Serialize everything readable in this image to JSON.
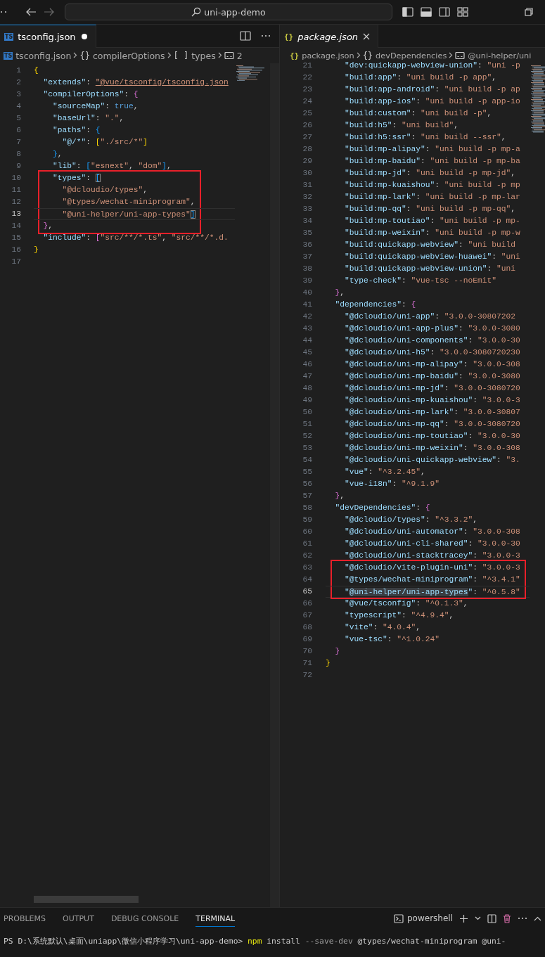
{
  "title_bar": {
    "search": "uni-app-demo"
  },
  "editors": [
    {
      "tab": {
        "kind": "ts",
        "badge": "TS",
        "label": "tsconfig.json",
        "modified": true,
        "preview": false,
        "selected": true
      },
      "breadcrumb": [
        {
          "kind": "ts",
          "badge": "TS",
          "label": "tsconfig.json"
        },
        {
          "kind": "object",
          "symbol": "{}",
          "label": "compilerOptions"
        },
        {
          "kind": "array",
          "symbol": "[ ]",
          "label": "types"
        },
        {
          "kind": "string",
          "label": "2"
        }
      ],
      "lines": [
        {
          "n": "1",
          "t": [
            {
              "kind": "brace1",
              "text": "{"
            }
          ],
          "current": false,
          "boxed": false
        },
        {
          "n": "2",
          "t": [
            {
              "kind": "key",
              "text": "  \"extends\""
            },
            {
              "kind": "punct",
              "text": ": "
            },
            {
              "kind": "link",
              "text": "\"@vue/tsconfig/tsconfig.json"
            }
          ],
          "current": false,
          "boxed": false
        },
        {
          "n": "3",
          "t": [
            {
              "kind": "key",
              "text": "  \"compilerOptions\""
            },
            {
              "kind": "punct",
              "text": ": "
            },
            {
              "kind": "brace2",
              "text": "{"
            }
          ],
          "current": false,
          "boxed": false
        },
        {
          "n": "4",
          "t": [
            {
              "kind": "key",
              "text": "    \"sourceMap\""
            },
            {
              "kind": "punct",
              "text": ": "
            },
            {
              "kind": "bool",
              "text": "true"
            },
            {
              "kind": "punct",
              "text": ","
            }
          ],
          "current": false,
          "boxed": false
        },
        {
          "n": "5",
          "t": [
            {
              "kind": "key",
              "text": "    \"baseUrl\""
            },
            {
              "kind": "punct",
              "text": ": "
            },
            {
              "kind": "str",
              "text": "\".\""
            },
            {
              "kind": "punct",
              "text": ","
            }
          ],
          "current": false,
          "boxed": false
        },
        {
          "n": "6",
          "t": [
            {
              "kind": "key",
              "text": "    \"paths\""
            },
            {
              "kind": "punct",
              "text": ": "
            },
            {
              "kind": "brace3",
              "text": "{"
            }
          ],
          "current": false,
          "boxed": false
        },
        {
          "n": "7",
          "t": [
            {
              "kind": "key",
              "text": "      \"@/*\""
            },
            {
              "kind": "punct",
              "text": ": "
            },
            {
              "kind": "brace1",
              "text": "["
            },
            {
              "kind": "str",
              "text": "\"./src/*\""
            },
            {
              "kind": "brace1",
              "text": "]"
            }
          ],
          "current": false,
          "boxed": false
        },
        {
          "n": "8",
          "t": [
            {
              "kind": "brace3",
              "text": "    }"
            },
            {
              "kind": "punct",
              "text": ","
            }
          ],
          "current": false,
          "boxed": false
        },
        {
          "n": "9",
          "t": [
            {
              "kind": "key",
              "text": "    \"lib\""
            },
            {
              "kind": "punct",
              "text": ": "
            },
            {
              "kind": "brace3",
              "text": "["
            },
            {
              "kind": "str",
              "text": "\"esnext\""
            },
            {
              "kind": "punct",
              "text": ", "
            },
            {
              "kind": "str",
              "text": "\"dom\""
            },
            {
              "kind": "brace3",
              "text": "]"
            },
            {
              "kind": "punct",
              "text": ","
            }
          ],
          "current": false,
          "boxed": false
        },
        {
          "n": "10",
          "t": [
            {
              "kind": "key",
              "text": "    \"types\""
            },
            {
              "kind": "punct",
              "text": ": "
            },
            {
              "kind": "match",
              "text": "["
            }
          ],
          "current": false,
          "boxed": true
        },
        {
          "n": "11",
          "t": [
            {
              "kind": "str",
              "text": "      \"@dcloudio/types\""
            },
            {
              "kind": "punct",
              "text": ","
            }
          ],
          "current": false,
          "boxed": true
        },
        {
          "n": "12",
          "t": [
            {
              "kind": "str",
              "text": "      \"@types/wechat-miniprogram\""
            },
            {
              "kind": "punct",
              "text": ","
            }
          ],
          "current": false,
          "boxed": true
        },
        {
          "n": "13",
          "t": [
            {
              "kind": "str",
              "text": "      \"@uni-helper/uni-app-types\""
            },
            {
              "kind": "match",
              "text": "]"
            }
          ],
          "current": true,
          "boxed": true
        },
        {
          "n": "14",
          "t": [
            {
              "kind": "brace2",
              "text": "  }"
            },
            {
              "kind": "punct",
              "text": ","
            }
          ],
          "current": false,
          "boxed": true
        },
        {
          "n": "15",
          "t": [
            {
              "kind": "key",
              "text": "  \"include\""
            },
            {
              "kind": "punct",
              "text": ": "
            },
            {
              "kind": "brace2",
              "text": "["
            },
            {
              "kind": "str",
              "text": "\"src/**/*.ts\""
            },
            {
              "kind": "punct",
              "text": ", "
            },
            {
              "kind": "str",
              "text": "\"src/**/*.d."
            }
          ],
          "current": false,
          "boxed": false
        },
        {
          "n": "16",
          "t": [
            {
              "kind": "brace1",
              "text": "}"
            }
          ],
          "current": false,
          "boxed": false
        },
        {
          "n": "17",
          "current": false,
          "boxed": false
        }
      ]
    },
    {
      "tab": {
        "kind": "json",
        "symbol": "{}",
        "label": "package.json",
        "modified": false,
        "preview": true,
        "selected": true
      },
      "breadcrumb": [
        {
          "kind": "json",
          "symbol": "{}",
          "label": "package.json"
        },
        {
          "kind": "object",
          "symbol": "{}",
          "label": "devDependencies"
        },
        {
          "kind": "string",
          "label": "@uni-helper/uni"
        }
      ],
      "lines": [
        {
          "n": "21",
          "t": [
            {
              "kind": "key",
              "text": "    \"dev:quickapp-webview-union\""
            },
            {
              "kind": "punct",
              "text": ": "
            },
            {
              "kind": "str",
              "text": "\"uni -p"
            }
          ],
          "current": false,
          "boxed": false
        },
        {
          "n": "22",
          "t": [
            {
              "kind": "key",
              "text": "    \"build:app\""
            },
            {
              "kind": "punct",
              "text": ": "
            },
            {
              "kind": "str",
              "text": "\"uni build -p app\""
            },
            {
              "kind": "punct",
              "text": ","
            }
          ],
          "current": false,
          "boxed": false
        },
        {
          "n": "23",
          "t": [
            {
              "kind": "key",
              "text": "    \"build:app-android\""
            },
            {
              "kind": "punct",
              "text": ": "
            },
            {
              "kind": "str",
              "text": "\"uni build -p ap"
            }
          ],
          "current": false,
          "boxed": false
        },
        {
          "n": "24",
          "t": [
            {
              "kind": "key",
              "text": "    \"build:app-ios\""
            },
            {
              "kind": "punct",
              "text": ": "
            },
            {
              "kind": "str",
              "text": "\"uni build -p app-io"
            }
          ],
          "current": false,
          "boxed": false
        },
        {
          "n": "25",
          "t": [
            {
              "kind": "key",
              "text": "    \"build:custom\""
            },
            {
              "kind": "punct",
              "text": ": "
            },
            {
              "kind": "str",
              "text": "\"uni build -p\""
            },
            {
              "kind": "punct",
              "text": ","
            }
          ],
          "current": false,
          "boxed": false
        },
        {
          "n": "26",
          "t": [
            {
              "kind": "key",
              "text": "    \"build:h5\""
            },
            {
              "kind": "punct",
              "text": ": "
            },
            {
              "kind": "str",
              "text": "\"uni build\""
            },
            {
              "kind": "punct",
              "text": ","
            }
          ],
          "current": false,
          "boxed": false
        },
        {
          "n": "27",
          "t": [
            {
              "kind": "key",
              "text": "    \"build:h5:ssr\""
            },
            {
              "kind": "punct",
              "text": ": "
            },
            {
              "kind": "str",
              "text": "\"uni build --ssr\""
            },
            {
              "kind": "punct",
              "text": ","
            }
          ],
          "current": false,
          "boxed": false
        },
        {
          "n": "28",
          "t": [
            {
              "kind": "key",
              "text": "    \"build:mp-alipay\""
            },
            {
              "kind": "punct",
              "text": ": "
            },
            {
              "kind": "str",
              "text": "\"uni build -p mp-a"
            }
          ],
          "current": false,
          "boxed": false
        },
        {
          "n": "29",
          "t": [
            {
              "kind": "key",
              "text": "    \"build:mp-baidu\""
            },
            {
              "kind": "punct",
              "text": ": "
            },
            {
              "kind": "str",
              "text": "\"uni build -p mp-ba"
            }
          ],
          "current": false,
          "boxed": false
        },
        {
          "n": "30",
          "t": [
            {
              "kind": "key",
              "text": "    \"build:mp-jd\""
            },
            {
              "kind": "punct",
              "text": ": "
            },
            {
              "kind": "str",
              "text": "\"uni build -p mp-jd\""
            },
            {
              "kind": "punct",
              "text": ","
            }
          ],
          "current": false,
          "boxed": false
        },
        {
          "n": "31",
          "t": [
            {
              "kind": "key",
              "text": "    \"build:mp-kuaishou\""
            },
            {
              "kind": "punct",
              "text": ": "
            },
            {
              "kind": "str",
              "text": "\"uni build -p mp"
            }
          ],
          "current": false,
          "boxed": false
        },
        {
          "n": "32",
          "t": [
            {
              "kind": "key",
              "text": "    \"build:mp-lark\""
            },
            {
              "kind": "punct",
              "text": ": "
            },
            {
              "kind": "str",
              "text": "\"uni build -p mp-lar"
            }
          ],
          "current": false,
          "boxed": false
        },
        {
          "n": "33",
          "t": [
            {
              "kind": "key",
              "text": "    \"build:mp-qq\""
            },
            {
              "kind": "punct",
              "text": ": "
            },
            {
              "kind": "str",
              "text": "\"uni build -p mp-qq\""
            },
            {
              "kind": "punct",
              "text": ","
            }
          ],
          "current": false,
          "boxed": false
        },
        {
          "n": "34",
          "t": [
            {
              "kind": "key",
              "text": "    \"build:mp-toutiao\""
            },
            {
              "kind": "punct",
              "text": ": "
            },
            {
              "kind": "str",
              "text": "\"uni build -p mp-"
            }
          ],
          "current": false,
          "boxed": false
        },
        {
          "n": "35",
          "t": [
            {
              "kind": "key",
              "text": "    \"build:mp-weixin\""
            },
            {
              "kind": "punct",
              "text": ": "
            },
            {
              "kind": "str",
              "text": "\"uni build -p mp-w"
            }
          ],
          "current": false,
          "boxed": false
        },
        {
          "n": "36",
          "t": [
            {
              "kind": "key",
              "text": "    \"build:quickapp-webview\""
            },
            {
              "kind": "punct",
              "text": ": "
            },
            {
              "kind": "str",
              "text": "\"uni build"
            }
          ],
          "current": false,
          "boxed": false
        },
        {
          "n": "37",
          "t": [
            {
              "kind": "key",
              "text": "    \"build:quickapp-webview-huawei\""
            },
            {
              "kind": "punct",
              "text": ": "
            },
            {
              "kind": "str",
              "text": "\"uni"
            }
          ],
          "current": false,
          "boxed": false
        },
        {
          "n": "38",
          "t": [
            {
              "kind": "key",
              "text": "    \"build:quickapp-webview-union\""
            },
            {
              "kind": "punct",
              "text": ": "
            },
            {
              "kind": "str",
              "text": "\"uni"
            }
          ],
          "current": false,
          "boxed": false
        },
        {
          "n": "39",
          "t": [
            {
              "kind": "key",
              "text": "    \"type-check\""
            },
            {
              "kind": "punct",
              "text": ": "
            },
            {
              "kind": "str",
              "text": "\"vue-tsc --noEmit\""
            }
          ],
          "current": false,
          "boxed": false
        },
        {
          "n": "40",
          "t": [
            {
              "kind": "brace2",
              "text": "  }"
            },
            {
              "kind": "punct",
              "text": ","
            }
          ],
          "current": false,
          "boxed": false
        },
        {
          "n": "41",
          "t": [
            {
              "kind": "key",
              "text": "  \"dependencies\""
            },
            {
              "kind": "punct",
              "text": ": "
            },
            {
              "kind": "brace2",
              "text": "{"
            }
          ],
          "current": false,
          "boxed": false
        },
        {
          "n": "42",
          "t": [
            {
              "kind": "key",
              "text": "    \"@dcloudio/uni-app\""
            },
            {
              "kind": "punct",
              "text": ": "
            },
            {
              "kind": "str",
              "text": "\"3.0.0-30807202"
            }
          ],
          "current": false,
          "boxed": false
        },
        {
          "n": "43",
          "t": [
            {
              "kind": "key",
              "text": "    \"@dcloudio/uni-app-plus\""
            },
            {
              "kind": "punct",
              "text": ": "
            },
            {
              "kind": "str",
              "text": "\"3.0.0-3080"
            }
          ],
          "current": false,
          "boxed": false
        },
        {
          "n": "44",
          "t": [
            {
              "kind": "key",
              "text": "    \"@dcloudio/uni-components\""
            },
            {
              "kind": "punct",
              "text": ": "
            },
            {
              "kind": "str",
              "text": "\"3.0.0-30"
            }
          ],
          "current": false,
          "boxed": false
        },
        {
          "n": "45",
          "t": [
            {
              "kind": "key",
              "text": "    \"@dcloudio/uni-h5\""
            },
            {
              "kind": "punct",
              "text": ": "
            },
            {
              "kind": "str",
              "text": "\"3.0.0-3080720230"
            }
          ],
          "current": false,
          "boxed": false
        },
        {
          "n": "46",
          "t": [
            {
              "kind": "key",
              "text": "    \"@dcloudio/uni-mp-alipay\""
            },
            {
              "kind": "punct",
              "text": ": "
            },
            {
              "kind": "str",
              "text": "\"3.0.0-308"
            }
          ],
          "current": false,
          "boxed": false
        },
        {
          "n": "47",
          "t": [
            {
              "kind": "key",
              "text": "    \"@dcloudio/uni-mp-baidu\""
            },
            {
              "kind": "punct",
              "text": ": "
            },
            {
              "kind": "str",
              "text": "\"3.0.0-3080"
            }
          ],
          "current": false,
          "boxed": false
        },
        {
          "n": "48",
          "t": [
            {
              "kind": "key",
              "text": "    \"@dcloudio/uni-mp-jd\""
            },
            {
              "kind": "punct",
              "text": ": "
            },
            {
              "kind": "str",
              "text": "\"3.0.0-3080720"
            }
          ],
          "current": false,
          "boxed": false
        },
        {
          "n": "49",
          "t": [
            {
              "kind": "key",
              "text": "    \"@dcloudio/uni-mp-kuaishou\""
            },
            {
              "kind": "punct",
              "text": ": "
            },
            {
              "kind": "str",
              "text": "\"3.0.0-3"
            }
          ],
          "current": false,
          "boxed": false
        },
        {
          "n": "50",
          "t": [
            {
              "kind": "key",
              "text": "    \"@dcloudio/uni-mp-lark\""
            },
            {
              "kind": "punct",
              "text": ": "
            },
            {
              "kind": "str",
              "text": "\"3.0.0-30807"
            }
          ],
          "current": false,
          "boxed": false
        },
        {
          "n": "51",
          "t": [
            {
              "kind": "key",
              "text": "    \"@dcloudio/uni-mp-qq\""
            },
            {
              "kind": "punct",
              "text": ": "
            },
            {
              "kind": "str",
              "text": "\"3.0.0-3080720"
            }
          ],
          "current": false,
          "boxed": false
        },
        {
          "n": "52",
          "t": [
            {
              "kind": "key",
              "text": "    \"@dcloudio/uni-mp-toutiao\""
            },
            {
              "kind": "punct",
              "text": ": "
            },
            {
              "kind": "str",
              "text": "\"3.0.0-30"
            }
          ],
          "current": false,
          "boxed": false
        },
        {
          "n": "53",
          "t": [
            {
              "kind": "key",
              "text": "    \"@dcloudio/uni-mp-weixin\""
            },
            {
              "kind": "punct",
              "text": ": "
            },
            {
              "kind": "str",
              "text": "\"3.0.0-308"
            }
          ],
          "current": false,
          "boxed": false
        },
        {
          "n": "54",
          "t": [
            {
              "kind": "key",
              "text": "    \"@dcloudio/uni-quickapp-webview\""
            },
            {
              "kind": "punct",
              "text": ": "
            },
            {
              "kind": "str",
              "text": "\"3."
            }
          ],
          "current": false,
          "boxed": false
        },
        {
          "n": "55",
          "t": [
            {
              "kind": "key",
              "text": "    \"vue\""
            },
            {
              "kind": "punct",
              "text": ": "
            },
            {
              "kind": "str",
              "text": "\"^3.2.45\""
            },
            {
              "kind": "punct",
              "text": ","
            }
          ],
          "current": false,
          "boxed": false
        },
        {
          "n": "56",
          "t": [
            {
              "kind": "key",
              "text": "    \"vue-i18n\""
            },
            {
              "kind": "punct",
              "text": ": "
            },
            {
              "kind": "str",
              "text": "\"^9.1.9\""
            }
          ],
          "current": false,
          "boxed": false
        },
        {
          "n": "57",
          "t": [
            {
              "kind": "brace2",
              "text": "  }"
            },
            {
              "kind": "punct",
              "text": ","
            }
          ],
          "current": false,
          "boxed": false
        },
        {
          "n": "58",
          "t": [
            {
              "kind": "key",
              "text": "  \"devDependencies\""
            },
            {
              "kind": "punct",
              "text": ": "
            },
            {
              "kind": "brace2",
              "text": "{"
            }
          ],
          "current": false,
          "boxed": false
        },
        {
          "n": "59",
          "t": [
            {
              "kind": "key",
              "text": "    \"@dcloudio/types\""
            },
            {
              "kind": "punct",
              "text": ": "
            },
            {
              "kind": "str",
              "text": "\"^3.3.2\""
            },
            {
              "kind": "punct",
              "text": ","
            }
          ],
          "current": false,
          "boxed": false
        },
        {
          "n": "60",
          "t": [
            {
              "kind": "key",
              "text": "    \"@dcloudio/uni-automator\""
            },
            {
              "kind": "punct",
              "text": ": "
            },
            {
              "kind": "str",
              "text": "\"3.0.0-308"
            }
          ],
          "current": false,
          "boxed": false
        },
        {
          "n": "61",
          "t": [
            {
              "kind": "key",
              "text": "    \"@dcloudio/uni-cli-shared\""
            },
            {
              "kind": "punct",
              "text": ": "
            },
            {
              "kind": "str",
              "text": "\"3.0.0-30"
            }
          ],
          "current": false,
          "boxed": false
        },
        {
          "n": "62",
          "t": [
            {
              "kind": "key",
              "text": "    \"@dcloudio/uni-stacktracey\""
            },
            {
              "kind": "punct",
              "text": ": "
            },
            {
              "kind": "str",
              "text": "\"3.0.0-3"
            }
          ],
          "current": false,
          "boxed": false
        },
        {
          "n": "63",
          "t": [
            {
              "kind": "key",
              "text": "    \"@dcloudio/vite-plugin-uni\""
            },
            {
              "kind": "punct",
              "text": ": "
            },
            {
              "kind": "str",
              "text": "\"3.0.0-3"
            }
          ],
          "current": false,
          "boxed": true
        },
        {
          "n": "64",
          "t": [
            {
              "kind": "key",
              "text": "    \"@types/wechat-miniprogram\""
            },
            {
              "kind": "punct",
              "text": ": "
            },
            {
              "kind": "str",
              "text": "\"^3.4.1\""
            }
          ],
          "current": false,
          "boxed": true
        },
        {
          "n": "65",
          "t": [
            {
              "kind": "key",
              "text": "    \""
            },
            {
              "kind": "found",
              "text": "@uni-helper/uni-app-types"
            },
            {
              "kind": "key",
              "text": "\""
            },
            {
              "kind": "punct",
              "text": ": "
            },
            {
              "kind": "str",
              "text": "\"^0.5.8\""
            }
          ],
          "current": true,
          "boxed": true
        },
        {
          "n": "66",
          "t": [
            {
              "kind": "key",
              "text": "    \"@vue/tsconfig\""
            },
            {
              "kind": "punct",
              "text": ": "
            },
            {
              "kind": "str",
              "text": "\"^0.1.3\""
            },
            {
              "kind": "punct",
              "text": ","
            }
          ],
          "current": false,
          "boxed": false
        },
        {
          "n": "67",
          "t": [
            {
              "kind": "key",
              "text": "    \"typescript\""
            },
            {
              "kind": "punct",
              "text": ": "
            },
            {
              "kind": "str",
              "text": "\"^4.9.4\""
            },
            {
              "kind": "punct",
              "text": ","
            }
          ],
          "current": false,
          "boxed": false
        },
        {
          "n": "68",
          "t": [
            {
              "kind": "key",
              "text": "    \"vite\""
            },
            {
              "kind": "punct",
              "text": ": "
            },
            {
              "kind": "str",
              "text": "\"4.0.4\""
            },
            {
              "kind": "punct",
              "text": ","
            }
          ],
          "current": false,
          "boxed": false
        },
        {
          "n": "69",
          "t": [
            {
              "kind": "key",
              "text": "    \"vue-tsc\""
            },
            {
              "kind": "punct",
              "text": ": "
            },
            {
              "kind": "str",
              "text": "\"^1.0.24\""
            }
          ],
          "current": false,
          "boxed": false
        },
        {
          "n": "70",
          "t": [
            {
              "kind": "brace2",
              "text": "  }"
            }
          ],
          "current": false,
          "boxed": false
        },
        {
          "n": "71",
          "t": [
            {
              "kind": "brace1",
              "text": "}"
            }
          ],
          "current": false,
          "boxed": false
        },
        {
          "n": "72",
          "current": false,
          "boxed": false
        }
      ]
    }
  ],
  "panel": {
    "tabs": [
      {
        "label": "PROBLEMS",
        "selected": false
      },
      {
        "label": "OUTPUT",
        "selected": false
      },
      {
        "label": "DEBUG CONSOLE",
        "selected": false
      },
      {
        "label": "TERMINAL",
        "selected": true
      }
    ],
    "shell": "powershell",
    "terminal": [
      {
        "kind": "prompt",
        "text": "PS D:\\系统默认\\桌面\\uniapp\\微信小程序学习\\uni-app-demo> "
      },
      {
        "kind": "command",
        "text": "npm"
      },
      {
        "kind": "arg",
        "text": " install"
      },
      {
        "kind": "flag",
        "text": " --save-dev"
      },
      {
        "kind": "arg",
        "text": " @types/wechat-miniprogram @uni-"
      }
    ]
  }
}
